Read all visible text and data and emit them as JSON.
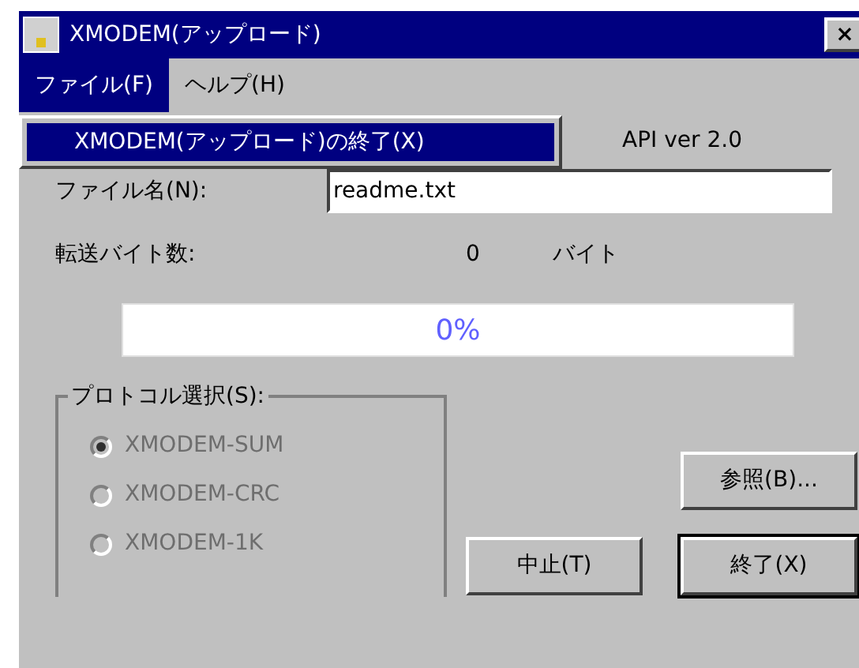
{
  "window": {
    "title": "XMODEM(アップロード)",
    "close": "×"
  },
  "menu_bar": [
    {
      "label": "ファイル(F)",
      "selected": true
    },
    {
      "label": "ヘルプ(H)",
      "selected": false
    }
  ],
  "open_menu": {
    "items": [
      {
        "label": "XMODEM(アップロード)の終了(X)",
        "selected": true
      }
    ]
  },
  "info_line": "API ver 2.0",
  "file_name": {
    "label": "ファイル名(N):",
    "value": "readme.txt"
  },
  "bytes": {
    "label": "転送バイト数:",
    "value": "0",
    "unit": "バイト"
  },
  "progress": {
    "level": 0,
    "reading": "0%"
  },
  "protocol": {
    "title": "プロトコル選択(S):",
    "disabled": true,
    "options": [
      {
        "label": "XMODEM-SUM",
        "selected": true
      },
      {
        "label": "XMODEM-CRC",
        "selected": false
      },
      {
        "label": "XMODEM-1K",
        "selected": false
      }
    ]
  },
  "buttons": [
    {
      "label": "参照(B)...",
      "default": false
    },
    {
      "label": "中止(T)",
      "default": false
    },
    {
      "label": "終了(X)",
      "default": true
    }
  ]
}
